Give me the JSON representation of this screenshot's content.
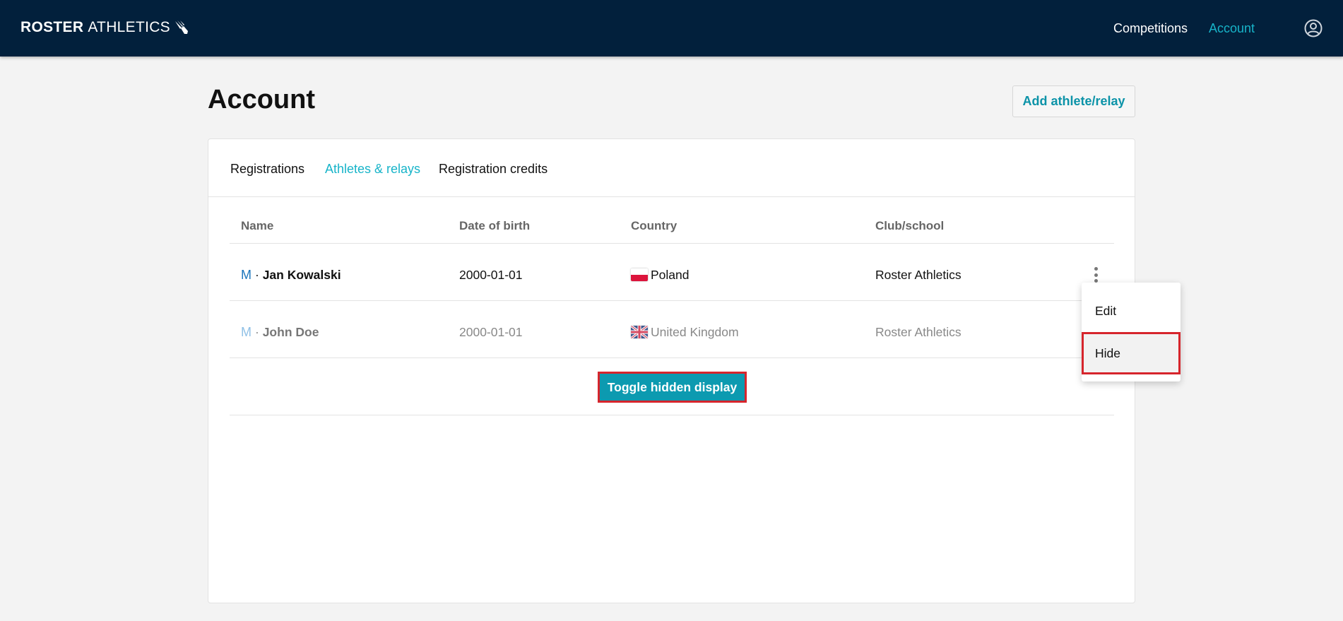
{
  "header": {
    "logo_bold": "ROSTER",
    "logo_light": "ATHLETICS",
    "nav": [
      {
        "label": "Competitions",
        "active": false
      },
      {
        "label": "Account",
        "active": true
      }
    ],
    "colors": {
      "bar": "#02203c",
      "accent": "#17b4c9"
    }
  },
  "page": {
    "title": "Account",
    "add_button": "Add athlete/relay"
  },
  "tabs": [
    {
      "label": "Registrations",
      "active": false
    },
    {
      "label": "Athletes & relays",
      "active": true
    },
    {
      "label": "Registration credits",
      "active": false
    }
  ],
  "table": {
    "columns": [
      "Name",
      "Date of birth",
      "Country",
      "Club/school"
    ],
    "rows": [
      {
        "sex": "M",
        "sep": "·",
        "name": "Jan Kowalski",
        "dob": "2000-01-01",
        "country": "Poland",
        "flag": "pl-flag-icon",
        "club": "Roster Athletics",
        "hidden": false
      },
      {
        "sex": "M",
        "sep": "·",
        "name": "John Doe",
        "dob": "2000-01-01",
        "country": "United Kingdom",
        "flag": "uk-flag-icon",
        "club": "Roster Athletics",
        "hidden": true
      }
    ]
  },
  "toggle_button": "Toggle hidden display",
  "context_menu": {
    "items": [
      "Edit",
      "Hide"
    ]
  }
}
